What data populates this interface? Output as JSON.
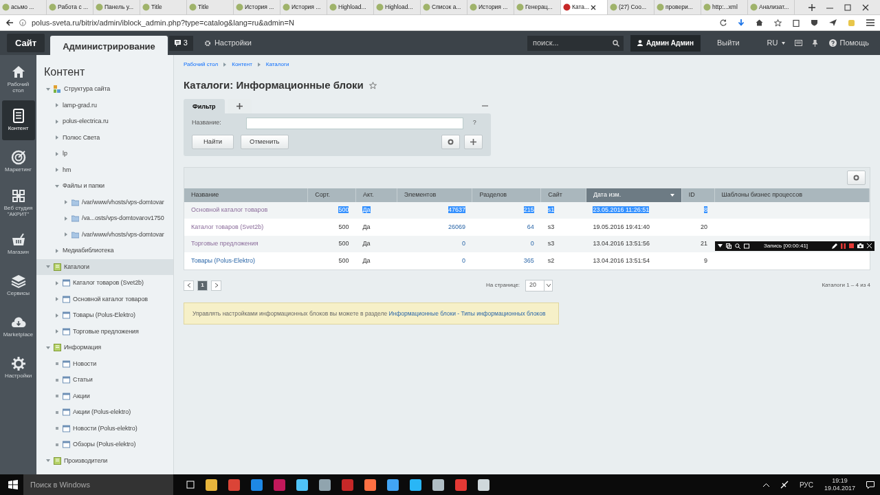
{
  "browser": {
    "tabs": [
      {
        "title": "асьмо ...",
        "selected": false
      },
      {
        "title": "Работа с ...",
        "selected": false
      },
      {
        "title": "Панель у...",
        "selected": false
      },
      {
        "title": "Title",
        "selected": false
      },
      {
        "title": "Title",
        "selected": false
      },
      {
        "title": "История ...",
        "selected": false
      },
      {
        "title": "История ...",
        "selected": false
      },
      {
        "title": "Highload...",
        "selected": false
      },
      {
        "title": "Highload...",
        "selected": false
      },
      {
        "title": "Список а...",
        "selected": false
      },
      {
        "title": "История ...",
        "selected": false
      },
      {
        "title": "Генерац...",
        "selected": false
      },
      {
        "title": "Ката...",
        "selected": true
      },
      {
        "title": "(27) Соо...",
        "selected": false
      },
      {
        "title": "провери...",
        "selected": false
      },
      {
        "title": "http:...xml",
        "selected": false
      },
      {
        "title": "Анализат...",
        "selected": false
      }
    ],
    "address": "polus-sveta.ru/bitrix/admin/iblock_admin.php?type=catalog&lang=ru&admin=N"
  },
  "admin_bar": {
    "site_button": "Сайт",
    "admin_tab": "Администрирование",
    "notifications": "3",
    "settings": "Настройки",
    "search_placeholder": "поиск...",
    "user": "Админ Админ",
    "logout": "Выйти",
    "language": "RU",
    "help": "Помощь"
  },
  "menu": [
    {
      "label": "Рабочий стол",
      "selected": false
    },
    {
      "label": "Контент",
      "selected": true
    },
    {
      "label": "Маркетинг",
      "selected": false
    },
    {
      "label": "Веб студия \"АКРИТ\"",
      "selected": false
    },
    {
      "label": "Магазин",
      "selected": false
    },
    {
      "label": "Сервисы",
      "selected": false
    },
    {
      "label": "Marketplace",
      "selected": false
    },
    {
      "label": "Настройки",
      "selected": false
    }
  ],
  "tree": {
    "title": "Контент",
    "items": [
      {
        "label": "Структура сайта",
        "kind": "structure",
        "expanded": true,
        "selected": false,
        "children": [
          {
            "label": "lamp-grad.ru",
            "kind": "site",
            "expanded": false,
            "selected": false
          },
          {
            "label": "polus-electrica.ru",
            "kind": "site",
            "expanded": false,
            "selected": false
          },
          {
            "label": "Полюс Света",
            "kind": "site",
            "expanded": false,
            "selected": false
          },
          {
            "label": "lp",
            "kind": "site",
            "expanded": false,
            "selected": false
          },
          {
            "label": "hm",
            "kind": "site",
            "expanded": false,
            "selected": false
          },
          {
            "label": "Файлы и папки",
            "kind": "site",
            "expanded": true,
            "selected": false,
            "children": [
              {
                "label": "/var/www/vhosts/vps-domtovar",
                "kind": "folder",
                "expanded": false,
                "selected": false
              },
              {
                "label": "/va...osts/vps-domtovarov1750",
                "kind": "folder",
                "expanded": false,
                "selected": false
              },
              {
                "label": "/var/www/vhosts/vps-domtovar",
                "kind": "folder",
                "expanded": false,
                "selected": false
              }
            ]
          },
          {
            "label": "Медиабиблиотека",
            "kind": "site",
            "expanded": false,
            "selected": false
          }
        ]
      },
      {
        "label": "Каталоги",
        "kind": "type",
        "expanded": true,
        "selected": true,
        "children": [
          {
            "label": "Каталог товаров (Svet2b)",
            "kind": "block",
            "expanded": false,
            "selected": false
          },
          {
            "label": "Основной каталог товаров",
            "kind": "block",
            "expanded": false,
            "selected": false
          },
          {
            "label": "Товары (Polus-Elektro)",
            "kind": "block",
            "expanded": false,
            "selected": false
          },
          {
            "label": "Торговые предложения",
            "kind": "block",
            "expanded": false,
            "selected": false
          }
        ]
      },
      {
        "label": "Информация",
        "kind": "type",
        "expanded": true,
        "selected": false,
        "children": [
          {
            "label": "Новости",
            "kind": "block",
            "selected": false
          },
          {
            "label": "Статьи",
            "kind": "block",
            "selected": false
          },
          {
            "label": "Акции",
            "kind": "block",
            "selected": false
          },
          {
            "label": "Акции (Polus-elektro)",
            "kind": "block",
            "selected": false
          },
          {
            "label": "Новости (Polus-elektro)",
            "kind": "block",
            "selected": false
          },
          {
            "label": "Обзоры (Polus-elektro)",
            "kind": "block",
            "selected": false
          }
        ]
      },
      {
        "label": "Производители",
        "kind": "type",
        "expanded": true,
        "selected": false
      }
    ]
  },
  "breadcrumb": [
    "Рабочий стол",
    "Контент",
    "Каталоги"
  ],
  "page_title": "Каталоги: Информационные блоки",
  "filter": {
    "tabs": [
      {
        "label": "Фильтр",
        "selected": true
      }
    ],
    "field_label": "Название:",
    "help": "?",
    "find": "Найти",
    "cancel": "Отменить"
  },
  "table": {
    "columns": [
      {
        "label": "Название",
        "sorted": false
      },
      {
        "label": "Сорт.",
        "sorted": false
      },
      {
        "label": "Акт.",
        "sorted": false
      },
      {
        "label": "Элементов",
        "sorted": false
      },
      {
        "label": "Разделов",
        "sorted": false
      },
      {
        "label": "Сайт",
        "sorted": false
      },
      {
        "label": "Дата изм.",
        "sorted": true
      },
      {
        "label": "ID",
        "sorted": false
      },
      {
        "label": "Шаблоны бизнес процессов",
        "sorted": false
      }
    ],
    "rows": [
      {
        "cells": [
          "Основной каталог товаров",
          "500",
          "Да",
          "47637",
          "215",
          "s1",
          "23.05.2016 11:26:51",
          "8"
        ],
        "visited": true,
        "text_selected": true
      },
      {
        "cells": [
          "Каталог товаров (Svet2b)",
          "500",
          "Да",
          "26069",
          "64",
          "s3",
          "19.05.2016 19:41:40",
          "20"
        ],
        "visited": true,
        "text_selected": false
      },
      {
        "cells": [
          "Торговые предложения",
          "500",
          "Да",
          "0",
          "0",
          "s3",
          "13.04.2016 13:51:56",
          "21"
        ],
        "visited": true,
        "text_selected": false
      },
      {
        "cells": [
          "Товары (Polus-Elektro)",
          "500",
          "Да",
          "0",
          "365",
          "s2",
          "13.04.2016 13:51:54",
          "9"
        ],
        "visited": false,
        "text_selected": false
      }
    ],
    "pages": [
      {
        "label": "1",
        "selected": true
      }
    ],
    "per_page_label": "На странице:",
    "per_page": "20",
    "summary": "Каталоги 1 – 4 из 4"
  },
  "note": {
    "text": "Управлять настройками информационных блоков вы можете в разделе",
    "link": "Информационные блоки - Типы информационных блоков"
  },
  "recorder": {
    "label": "Запись [00:00:41]"
  },
  "taskbar": {
    "search": "Поиск в Windows",
    "language": "РУС",
    "time": "19:19",
    "date": "19.04.2017"
  }
}
